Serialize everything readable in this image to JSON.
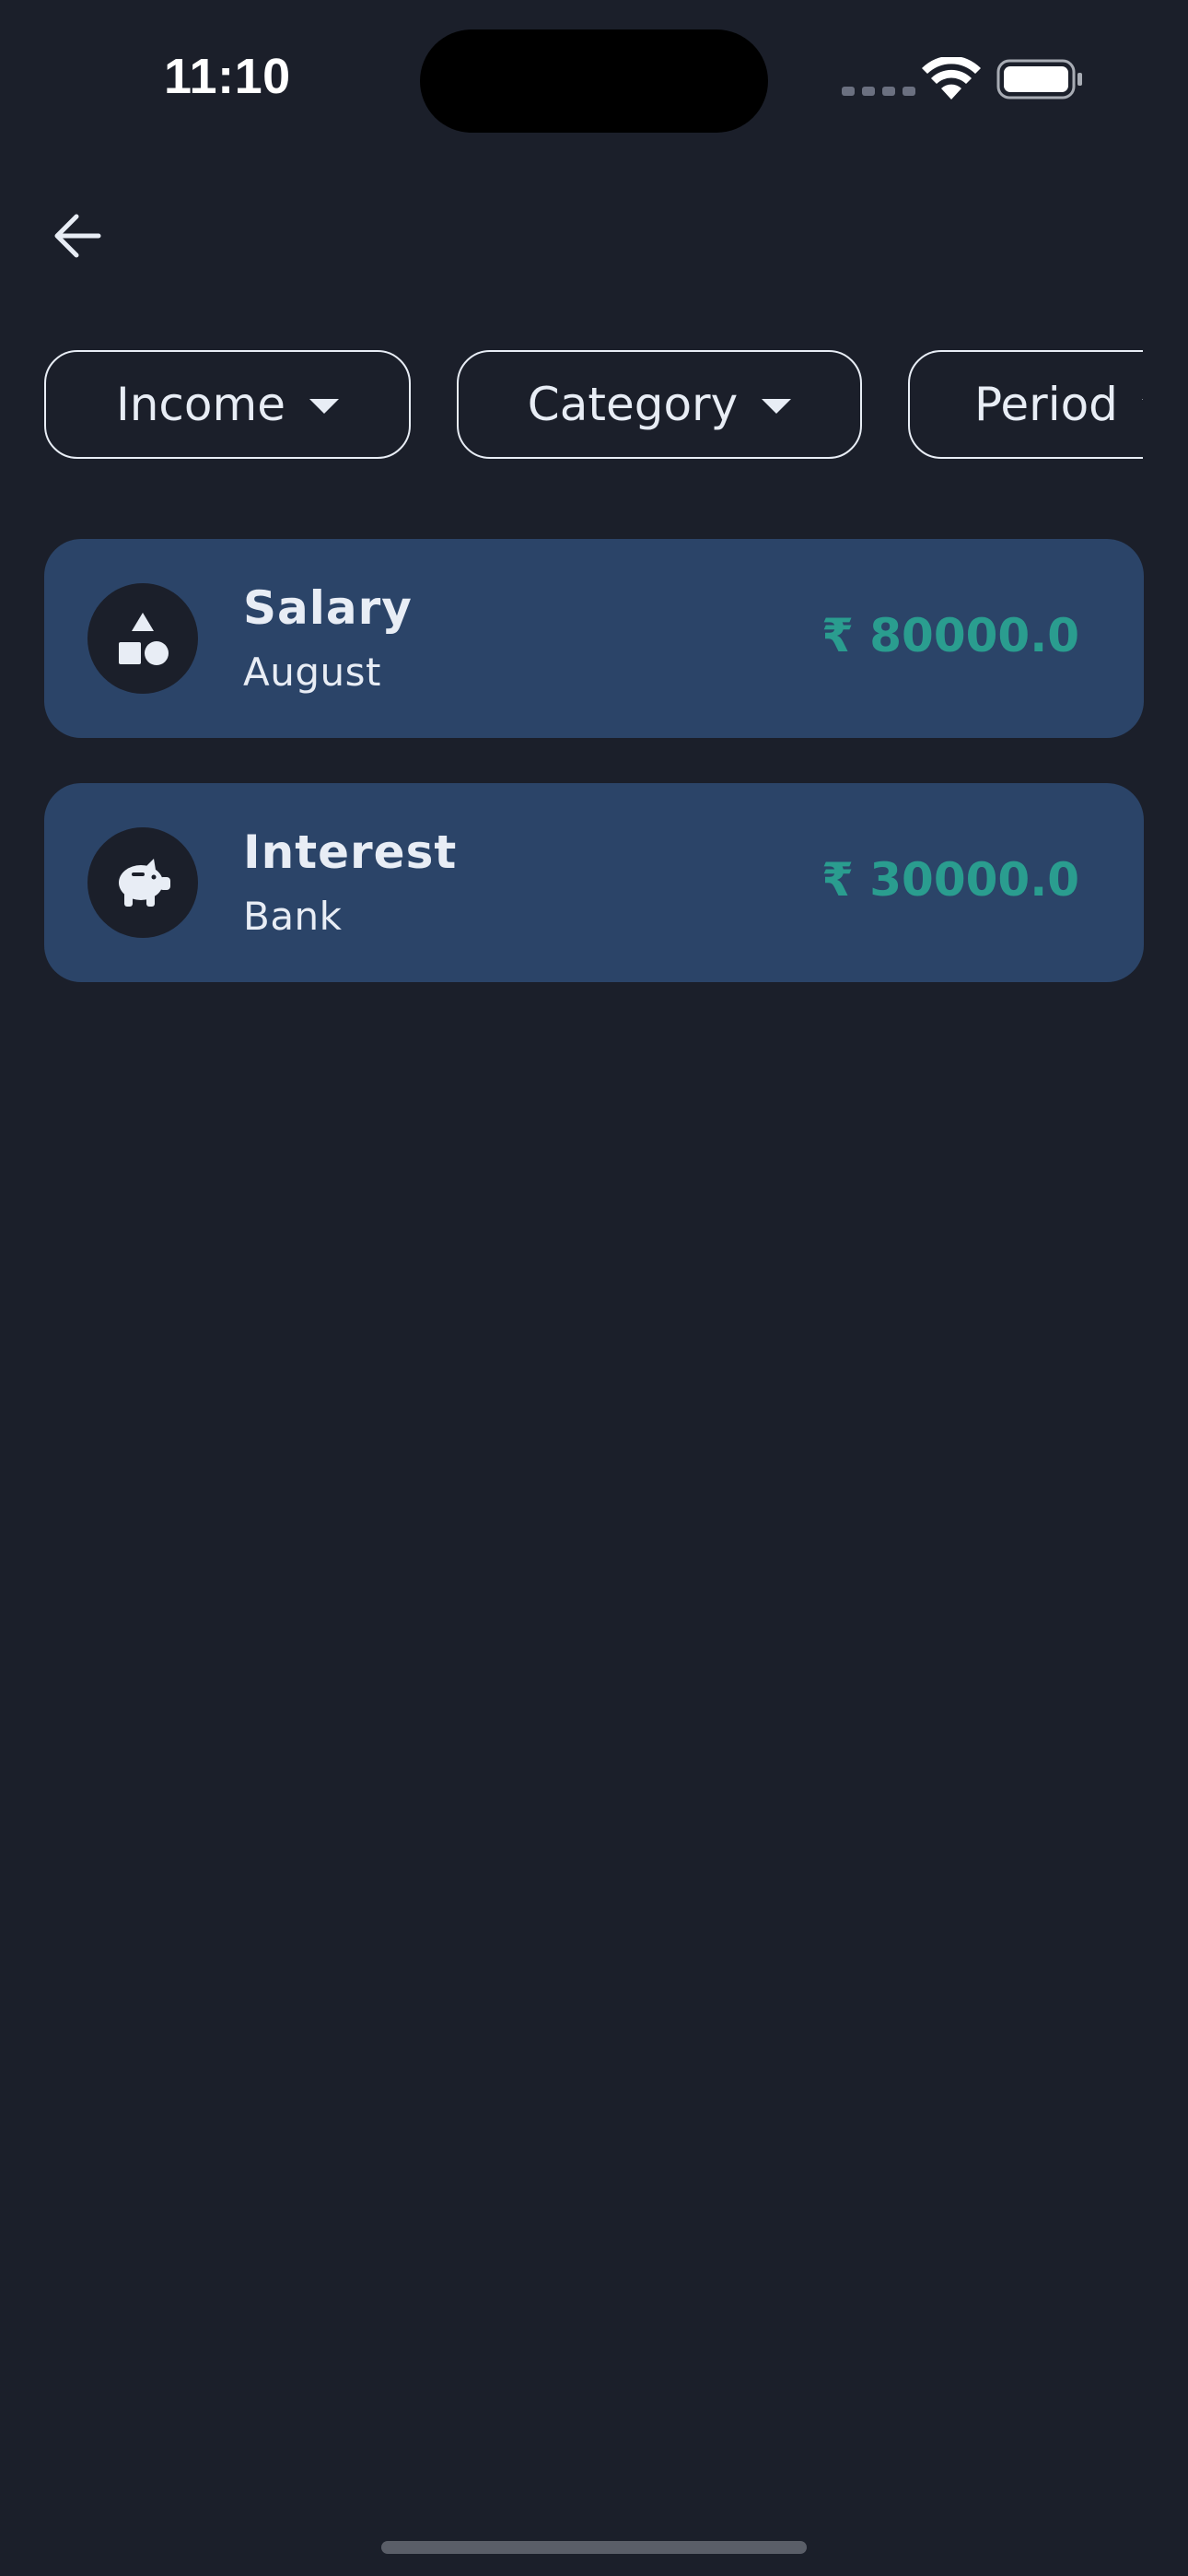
{
  "status_bar": {
    "time": "11:10",
    "wifi_icon": "wifi-icon",
    "battery_icon": "battery-full-icon"
  },
  "header": {
    "back_icon": "arrow-left-icon"
  },
  "filters": [
    {
      "label": "Income",
      "icon": "caret-down-icon"
    },
    {
      "label": "Category",
      "icon": "caret-down-icon"
    },
    {
      "label": "Period",
      "icon": "caret-down-icon"
    }
  ],
  "transactions": [
    {
      "title": "Salary",
      "subtitle": "August",
      "amount": "₹ 80000.0",
      "icon": "shapes-icon"
    },
    {
      "title": "Interest",
      "subtitle": "Bank",
      "amount": "₹ 30000.0",
      "icon": "piggy-bank-icon"
    }
  ],
  "colors": {
    "background": "#1b1f2a",
    "card": "#2b4468",
    "amount": "#2a9d8f",
    "text": "#e8edf5"
  }
}
